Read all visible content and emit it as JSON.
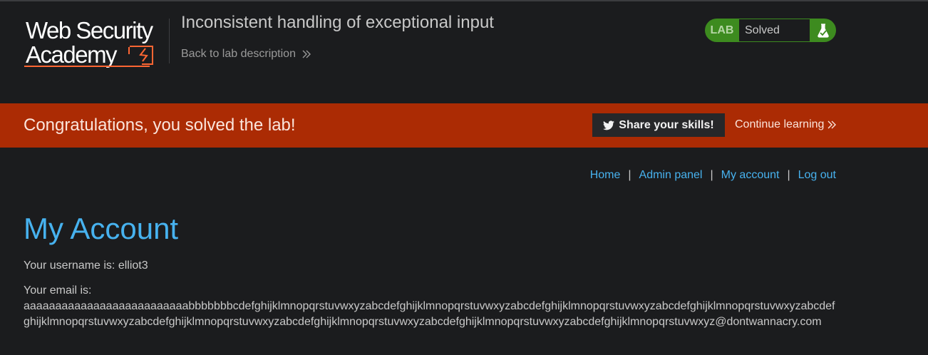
{
  "header": {
    "logo_text": [
      "Web Security",
      "Academy"
    ],
    "lab_title": "Inconsistent handling of exceptional input",
    "back_link": "Back to lab description",
    "status": {
      "badge": "LAB",
      "text": "Solved",
      "icon": "flask-icon",
      "color": "#3d8b1f"
    }
  },
  "banner": {
    "message": "Congratulations, you solved the lab!",
    "share_button": "Share your skills!",
    "continue_link": "Continue learning",
    "color": "#ab2b04"
  },
  "nav": {
    "items": [
      "Home",
      "Admin panel",
      "My account",
      "Log out"
    ],
    "separator": "|"
  },
  "account": {
    "heading": "My Account",
    "username_line": "Your username is: elliot3",
    "email_label": "Your email is:",
    "email_value": "aaaaaaaaaaaaaaaaaaaaaaaaaabbbbbbbcdefghijklmnopqrstuvwxyzabcdefghijklmnopqrstuvwxyzabcdefghijklmnopqrstuvwxyzabcdefghijklmnopqrstuvwxyzabcdefghijklmnopqrstuvwxyzabcdefghijklmnopqrstuvwxyzabcdefghijklmnopqrstuvwxyzabcdefghijklmnopqrstuvwxyzabcdefghijklmnopqrstuvwxyz@dontwannacry.com"
  },
  "colors": {
    "background": "#1b1c1e",
    "link": "#47b2ef",
    "accent": "#ff6633"
  }
}
